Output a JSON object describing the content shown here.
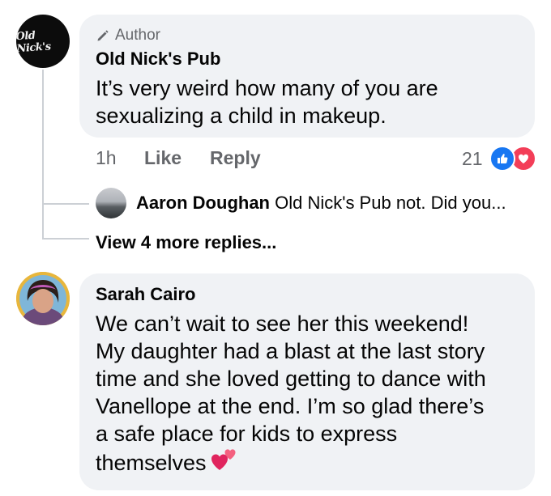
{
  "comment1": {
    "avatar_text": "Old Nick's",
    "author_badge": "Author",
    "name": "Old Nick's Pub",
    "text_lines": [
      "It’s very weird how many of you are",
      "sexualizing a child in makeup."
    ],
    "time": "1h",
    "like_label": "Like",
    "reply_label": "Reply",
    "reaction_count": "21",
    "reactions": [
      "like-icon",
      "love-icon"
    ]
  },
  "reply": {
    "name": "Aaron Doughan",
    "text": "Old Nick's Pub not. Did you..."
  },
  "view_more": "View 4 more replies...",
  "comment2": {
    "name": "Sarah Cairo",
    "text_lines": [
      "We can’t wait to see her this weekend!",
      "My daughter had a blast at the last story",
      "time and she loved getting to dance with",
      "Vanellope at the end. I’m so glad there’s",
      "a safe place for kids to express",
      "themselves"
    ],
    "emoji": "two-hearts-icon"
  },
  "colors": {
    "bubble": "#f0f2f5",
    "secondary_text": "#65676b",
    "like_blue": "#1877f2",
    "love_red": "#f33e58"
  }
}
